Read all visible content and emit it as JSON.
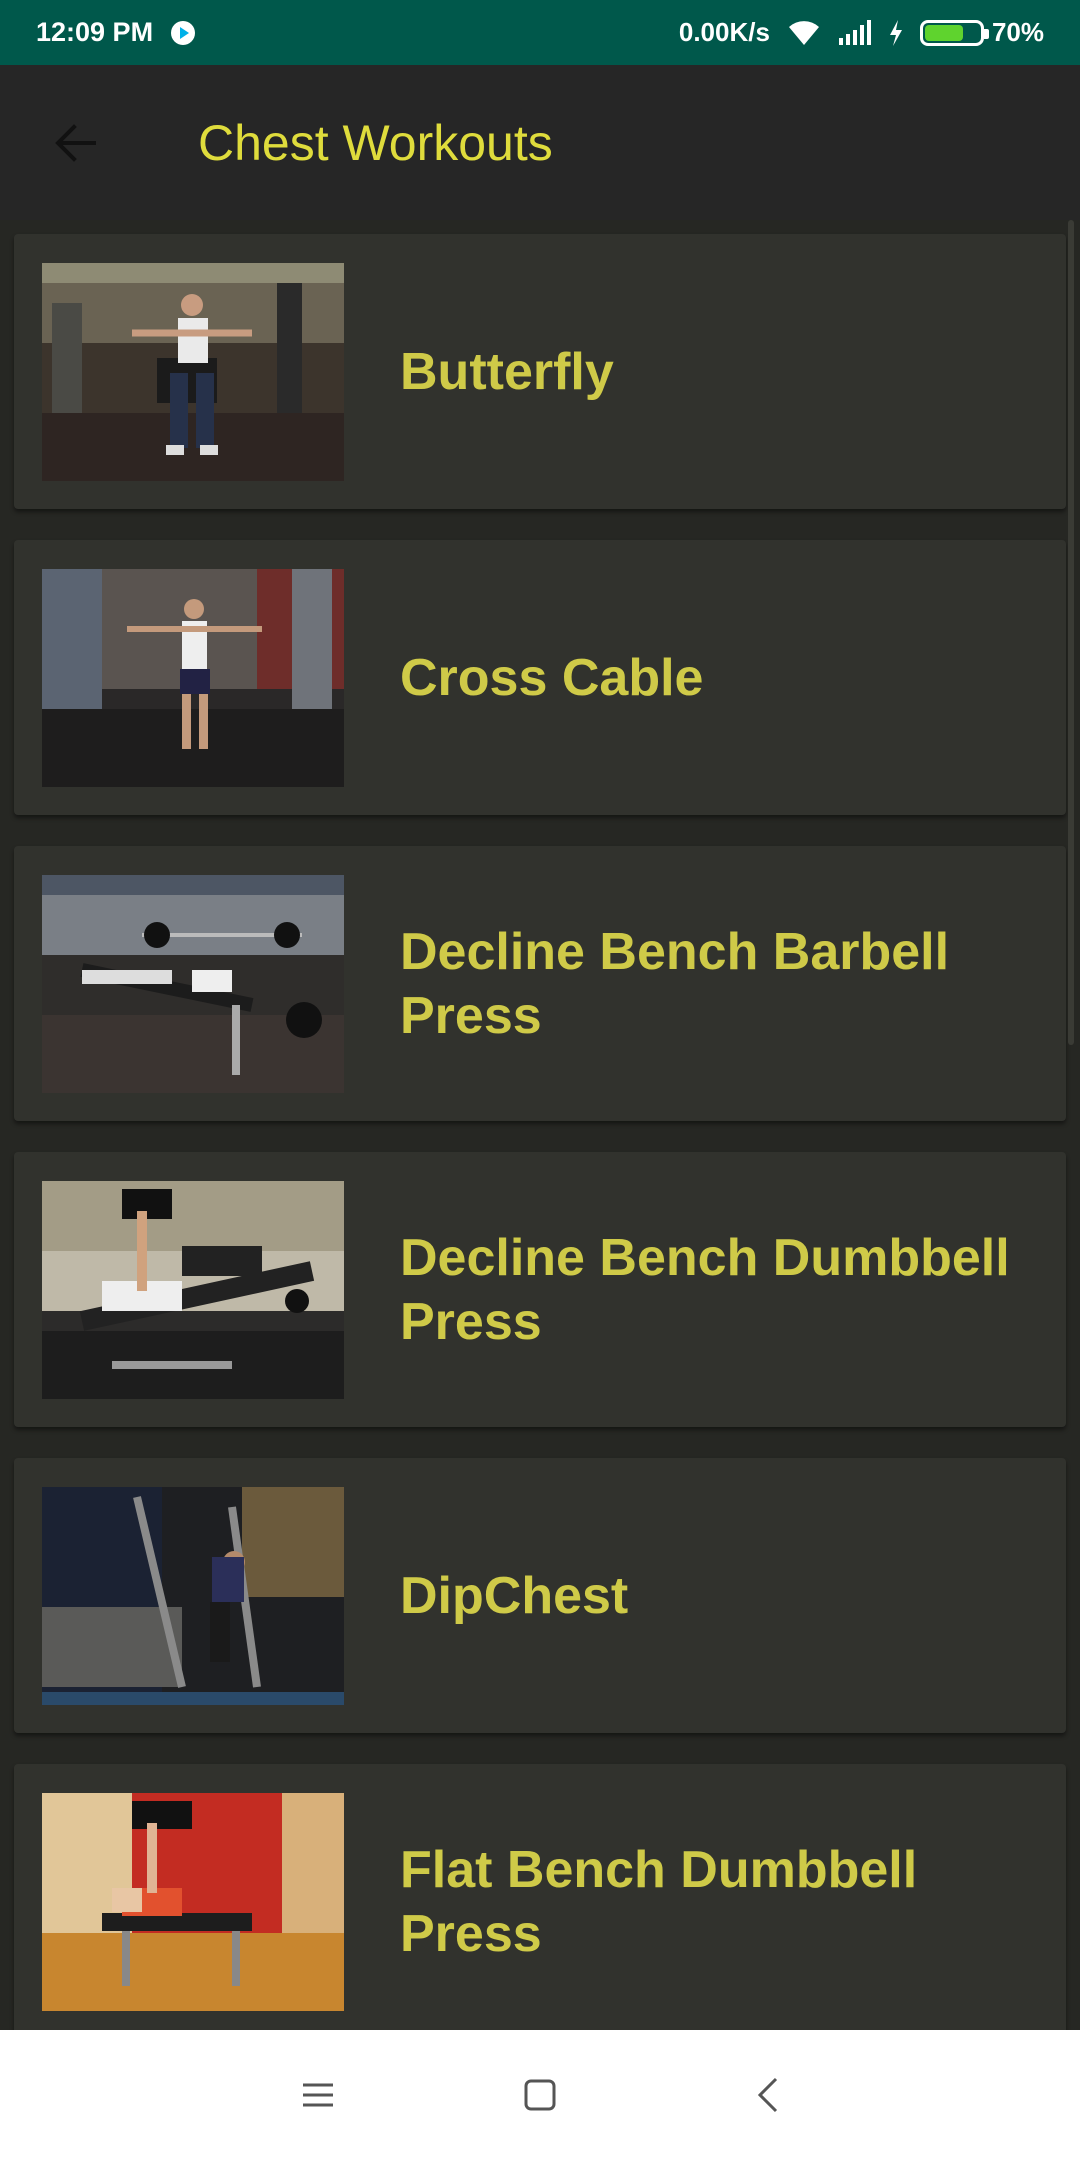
{
  "status_bar": {
    "time": "12:09 PM",
    "net_speed": "0.00K/s",
    "battery_pct": "70%",
    "battery_level": 0.7,
    "icons": [
      "play-icon",
      "wifi-icon",
      "signal-icon",
      "charging-icon",
      "battery-icon"
    ]
  },
  "app_bar": {
    "title": "Chest Workouts",
    "back_icon": "arrow-back-icon"
  },
  "workouts": [
    {
      "title": "Butterfly",
      "image": "butterfly-machine-photo"
    },
    {
      "title": "Cross Cable",
      "image": "cross-cable-photo"
    },
    {
      "title": "Decline Bench Barbell Press",
      "image": "decline-barbell-photo"
    },
    {
      "title": "Decline Bench Dumbbell Press",
      "image": "decline-dumbbell-photo"
    },
    {
      "title": "DipChest",
      "image": "dip-chest-photo"
    },
    {
      "title": "Flat Bench Dumbbell Press",
      "image": "flat-bench-dumbbell-photo"
    }
  ],
  "nav_bar": {
    "icons": [
      "menu-icon",
      "home-icon",
      "back-icon"
    ]
  },
  "colors": {
    "status_bar": "#00584b",
    "app_bar": "#262626",
    "title_yellow": "#dfdc3c",
    "card_bg": "#31322d",
    "card_text": "#cfca48"
  }
}
